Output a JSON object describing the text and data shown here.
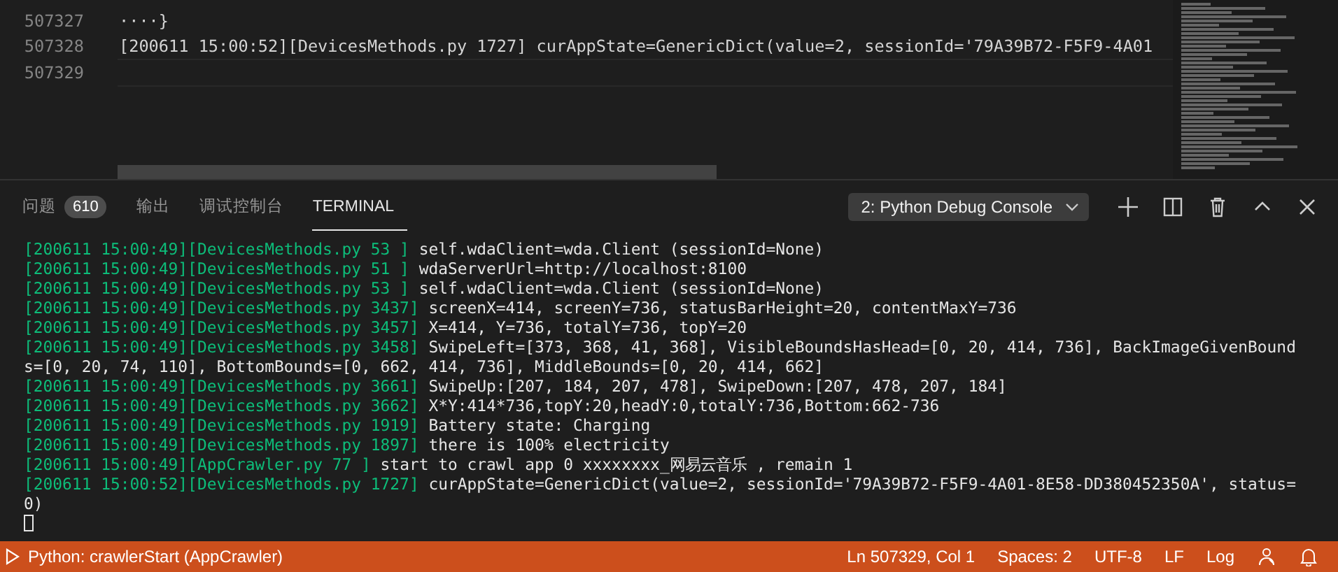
{
  "editor": {
    "lines": [
      {
        "number": "507327",
        "text": "····}"
      },
      {
        "number": "507328",
        "text": "[200611 15:00:52][DevicesMethods.py 1727] curAppState=GenericDict(value=2, sessionId='79A39B72-F5F9-4A01"
      },
      {
        "number": "507329"
      }
    ]
  },
  "panel": {
    "tabs": [
      {
        "label": "问题",
        "badge": "610",
        "selected": false
      },
      {
        "label": "输出",
        "selected": false
      },
      {
        "label": "调试控制台",
        "selected": false
      },
      {
        "label": "TERMINAL",
        "selected": true
      }
    ],
    "terminal_select": "2: Python Debug Console",
    "terminal_lines": [
      {
        "kind": "log",
        "prefix": "[200611 15:00:49][DevicesMethods.py 53 ]",
        "message": " self.wdaClient=wda.Client (sessionId=None)"
      },
      {
        "kind": "log",
        "prefix": "[200611 15:00:49][DevicesMethods.py 51 ]",
        "message": " wdaServerUrl=http://localhost:8100"
      },
      {
        "kind": "log",
        "prefix": "[200611 15:00:49][DevicesMethods.py 53 ]",
        "message": " self.wdaClient=wda.Client (sessionId=None)"
      },
      {
        "kind": "log",
        "prefix": "[200611 15:00:49][DevicesMethods.py 3437]",
        "message": " screenX=414, screenY=736, statusBarHeight=20, contentMaxY=736"
      },
      {
        "kind": "log",
        "prefix": "[200611 15:00:49][DevicesMethods.py 3457]",
        "message": " X=414, Y=736, totalY=736, topY=20"
      },
      {
        "kind": "log",
        "prefix": "[200611 15:00:49][DevicesMethods.py 3458]",
        "message": " SwipeLeft=[373, 368, 41, 368], VisibleBoundsHasHead=[0, 20, 414, 736], BackImageGivenBound"
      },
      {
        "kind": "plain",
        "text": "s=[0, 20, 74, 110], BottomBounds=[0, 662, 414, 736], MiddleBounds=[0, 20, 414, 662]"
      },
      {
        "kind": "log",
        "prefix": "[200611 15:00:49][DevicesMethods.py 3661]",
        "message": " SwipeUp:[207, 184, 207, 478], SwipeDown:[207, 478, 207, 184]"
      },
      {
        "kind": "log",
        "prefix": "[200611 15:00:49][DevicesMethods.py 3662]",
        "message": " X*Y:414*736,topY:20,headY:0,totalY:736,Bottom:662-736"
      },
      {
        "kind": "log",
        "prefix": "[200611 15:00:49][DevicesMethods.py 1919]",
        "message": " Battery state: Charging"
      },
      {
        "kind": "log",
        "prefix": "[200611 15:00:49][DevicesMethods.py 1897]",
        "message": " there is 100% electricity"
      },
      {
        "kind": "log",
        "prefix": "[200611 15:00:49][AppCrawler.py 77 ]",
        "message": " start to crawl app 0 xxxxxxxx_网易云音乐 , remain 1"
      },
      {
        "kind": "log",
        "prefix": "[200611 15:00:52][DevicesMethods.py 1727]",
        "message": " curAppState=GenericDict(value=2, sessionId='79A39B72-F5F9-4A01-8E58-DD380452350A', status="
      },
      {
        "kind": "plain",
        "text": "0)"
      }
    ]
  },
  "status_bar": {
    "debug_target": "Python: crawlerStart (AppCrawler)",
    "items": [
      "Ln 507329, Col 1",
      "Spaces: 2",
      "UTF-8",
      "LF",
      "Log"
    ]
  }
}
